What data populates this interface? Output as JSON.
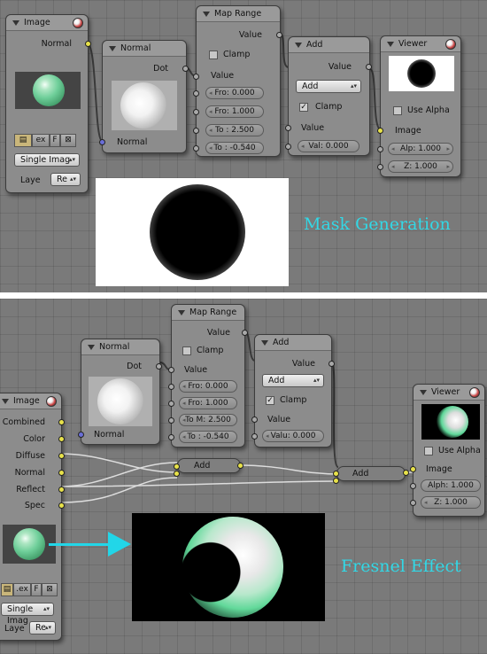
{
  "accent_color": "#32d8e6",
  "top": {
    "caption": "Mask Generation",
    "image_node": {
      "title": "Image",
      "output": "Normal",
      "ext_btn": "ex",
      "f_btn": "F",
      "source": "Single Imag",
      "layer_label": "Laye",
      "layer_value": "Re"
    },
    "normal_node": {
      "title": "Normal",
      "output": "Dot",
      "input": "Normal"
    },
    "map_range": {
      "title": "Map Range",
      "output": "Value",
      "clamp": "Clamp",
      "clamp_checked": false,
      "input": "Value",
      "fro_min": "Fro: 0.000",
      "fro_max": "Fro: 1.000",
      "to_min": "To : 2.500",
      "to_max": "To : -0.540"
    },
    "add_node": {
      "title": "Add",
      "output": "Value",
      "operation": "Add",
      "clamp": "Clamp",
      "clamp_checked": true,
      "input": "Value",
      "val": "Val: 0.000"
    },
    "viewer": {
      "title": "Viewer",
      "use_alpha": "Use Alpha",
      "input": "Image",
      "alpha": "Alp: 1.000",
      "z": "Z: 1.000"
    }
  },
  "bottom": {
    "caption": "Fresnel Effect",
    "image_node": {
      "title": "Image",
      "outputs": [
        "Combined",
        "Color",
        "Diffuse",
        "Normal",
        "Reflect",
        "Spec"
      ],
      "ext_btn": ".ex",
      "f_btn": "F",
      "source": "Single Imag",
      "layer_label": "Laye",
      "layer_value": "Re"
    },
    "normal_node": {
      "title": "Normal",
      "output": "Dot",
      "input": "Normal"
    },
    "map_range": {
      "title": "Map Range",
      "output": "Value",
      "clamp": "Clamp",
      "clamp_checked": false,
      "input": "Value",
      "fro_min": "Fro: 0.000",
      "fro_max": "Fro: 1.000",
      "to_min": "To M: 2.500",
      "to_max": "To : -0.540"
    },
    "add_node": {
      "title": "Add",
      "output": "Value",
      "operation": "Add",
      "clamp": "Clamp",
      "clamp_checked": true,
      "input": "Value",
      "val": "Valu: 0.000"
    },
    "add_pill_1": "Add",
    "add_pill_2": "Add",
    "viewer": {
      "title": "Viewer",
      "use_alpha": "Use Alpha",
      "input": "Image",
      "alpha": "Alph: 1.000",
      "z": "Z: 1.000"
    }
  }
}
